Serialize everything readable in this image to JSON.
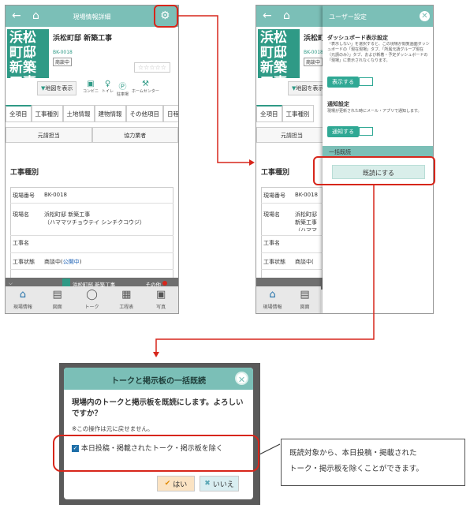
{
  "left": {
    "title": "現場情報詳細",
    "logo_text": "浜松町邸新築工事",
    "site_name": "浜松町邸 新築工事",
    "code": "BK-0018",
    "status": "商談中",
    "stars": "☆☆☆☆☆",
    "map_btn": "地図を表示",
    "amenities": [
      "コンビニ",
      "トイレ",
      "駐車場",
      "ホームセンター"
    ],
    "tabs": [
      "全項目",
      "工事種別",
      "土地情報",
      "建物情報",
      "その他項目",
      "日程"
    ],
    "sub_tabs": [
      "元請担当",
      "協力業者"
    ],
    "section_title": "工事種別",
    "rows": [
      {
        "k": "現場番号",
        "v": "BK-0018"
      },
      {
        "k": "現場名",
        "v": "浜松町邸 新築工事\n（ハママツチョウテイ シンチクコウジ）"
      },
      {
        "k": "工事名",
        "v": ""
      },
      {
        "k": "工事状態",
        "v": "商談中(",
        "v2": "公開中",
        ")": ")"
      }
    ],
    "bottom_strip_name": "浜松町邸 新築工事",
    "bottom_strip_other": "その他",
    "nav": [
      "現場情報",
      "図面",
      "トーク",
      "工程表",
      "写真"
    ]
  },
  "right": {
    "panel_title": "ユーザー設定",
    "dash_title": "ダッシュボード表示設定",
    "dash_desc": "「表示しない」を選択すると、この現場が閲覧画面ダッシュボードの「現在現場」タブ、「所属元請グループ現在（元請のみ）」タブ、および新着・予定ダッシュボードの「現場」に表示されなくなります。",
    "show_btn": "表示する",
    "notify_title": "通知設定",
    "notify_desc": "現場が更新された時にメール・アプリで通知します。",
    "notify_btn": "通知する",
    "bulk_title": "一括既読",
    "bulk_btn": "既読にする"
  },
  "dialog": {
    "title": "トークと掲示板の一括既読",
    "message": "現場内のトークと掲示板を既読にします。よろしいですか？",
    "note": "※この操作は元に戻せません。",
    "checkbox_label": "本日投稿・掲載されたトーク・掲示板を除く",
    "yes": "はい",
    "no": "いいえ"
  },
  "callout": {
    "line1": "既読対象から、本日投稿・掲載された",
    "line2": "トーク・掲示板を除くことができます。"
  },
  "colors": {
    "teal": "#7bbfb7",
    "dark_teal": "#2f9a86",
    "red": "#d7261b"
  }
}
